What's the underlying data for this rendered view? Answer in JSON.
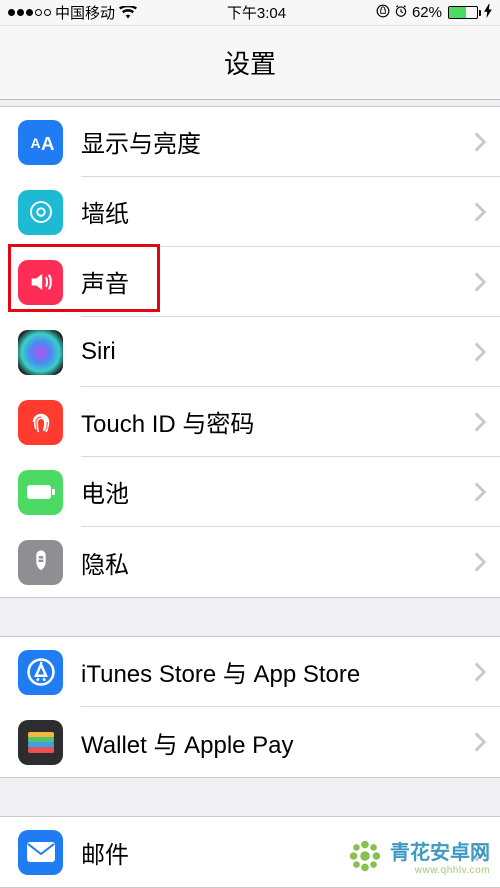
{
  "status_bar": {
    "carrier": "中国移动",
    "time": "下午3:04",
    "battery_pct": "62%"
  },
  "nav": {
    "title": "设置"
  },
  "group1": [
    {
      "label": "显示与亮度",
      "icon": "display-icon",
      "bg": "bg-blue"
    },
    {
      "label": "墙纸",
      "icon": "wallpaper-icon",
      "bg": "bg-cyan"
    },
    {
      "label": "声音",
      "icon": "sound-icon",
      "bg": "bg-pink"
    },
    {
      "label": "Siri",
      "icon": "siri-icon",
      "bg": "bg-siri"
    },
    {
      "label": "Touch ID 与密码",
      "icon": "touchid-icon",
      "bg": "bg-red"
    },
    {
      "label": "电池",
      "icon": "battery-icon",
      "bg": "bg-green"
    },
    {
      "label": "隐私",
      "icon": "privacy-icon",
      "bg": "bg-gray"
    }
  ],
  "group2": [
    {
      "label": "iTunes Store 与 App Store",
      "icon": "appstore-icon",
      "bg": "bg-blue"
    },
    {
      "label": "Wallet 与 Apple Pay",
      "icon": "wallet-icon",
      "bg": "bg-dark"
    }
  ],
  "group3": [
    {
      "label": "邮件",
      "icon": "mail-icon",
      "bg": "bg-blue"
    }
  ],
  "watermark": {
    "brand": "青花安卓网",
    "url": "www.qhhlv.com"
  }
}
